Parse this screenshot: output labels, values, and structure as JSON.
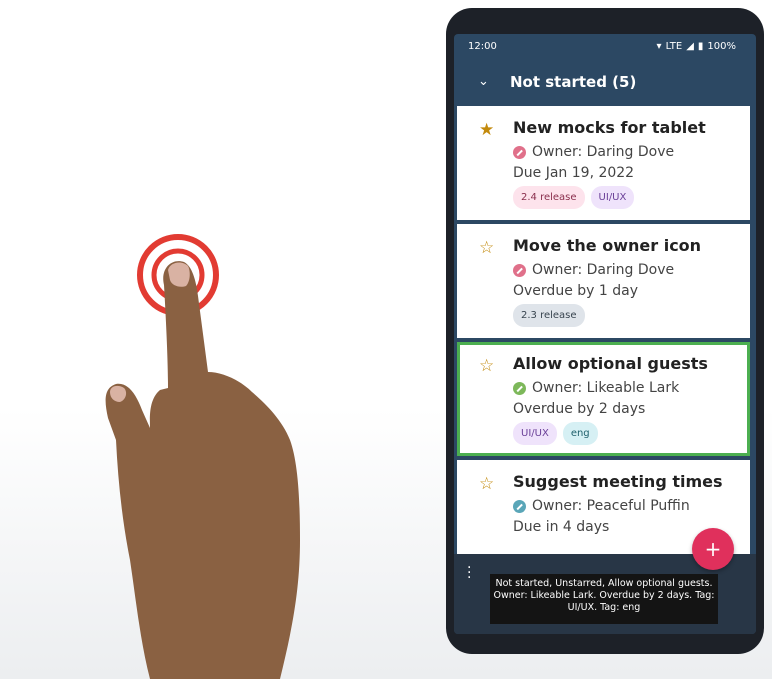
{
  "status": {
    "time": "12:00",
    "network": "LTE",
    "battery": "100%"
  },
  "header": {
    "section_title": "Not started (5)"
  },
  "tasks": [
    {
      "starred": "★",
      "title": "New mocks for tablet",
      "owner": "Owner: Daring Dove",
      "due": "Due Jan 19, 2022",
      "owner_color": "#e0708a",
      "tags": [
        {
          "label": "2.4 release",
          "bg": "#fde3ec",
          "fg": "#8a2f4d"
        },
        {
          "label": "UI/UX",
          "bg": "#efe3fb",
          "fg": "#6a3f98"
        }
      ]
    },
    {
      "starred": "☆",
      "title": "Move the owner icon",
      "owner": "Owner: Daring Dove",
      "due": "Overdue by 1 day",
      "owner_color": "#e0708a",
      "tags": [
        {
          "label": "2.3 release",
          "bg": "#dfe4ea",
          "fg": "#38444f"
        }
      ]
    },
    {
      "starred": "☆",
      "title": "Allow optional guests",
      "owner": "Owner: Likeable Lark",
      "due": "Overdue by 2 days",
      "owner_color": "#7db85a",
      "tags": [
        {
          "label": "UI/UX",
          "bg": "#efe3fb",
          "fg": "#6a3f98"
        },
        {
          "label": "eng",
          "bg": "#d6f0f4",
          "fg": "#1e5f6b"
        }
      ]
    },
    {
      "starred": "☆",
      "title": "Suggest meeting times",
      "owner": "Owner: Peaceful Puffin",
      "due": "Due in 4 days",
      "owner_color": "#5aa6b8",
      "tags": []
    }
  ],
  "fab_label": "+",
  "tooltip": "Not started, Unstarred, Allow optional guests. Owner: Likeable Lark. Overdue by 2 days. Tag: UI/UX. Tag: eng",
  "colors": {
    "app_bar": "#2c4863",
    "selection": "#4caf50",
    "fab": "#e0305c",
    "star": "#c38a0c"
  }
}
